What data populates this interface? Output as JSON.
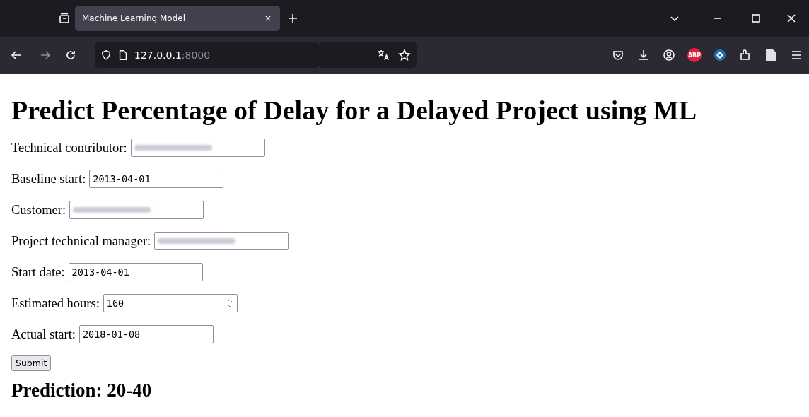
{
  "browser": {
    "tab": {
      "title": "Machine Learning Model",
      "selected": true
    },
    "url_host": "127.0.0.1",
    "url_port": ":8000",
    "extension_badge": "ABP"
  },
  "page": {
    "heading": "Predict Percentage of Delay for a Delayed Project using ML",
    "fields": [
      {
        "label": "Technical contributor:",
        "kind": "text",
        "redacted": true
      },
      {
        "label": "Baseline start:",
        "kind": "text",
        "redacted": false,
        "value": "2013-04-01"
      },
      {
        "label": "Customer:",
        "kind": "text",
        "redacted": true
      },
      {
        "label": "Project technical manager:",
        "kind": "text",
        "redacted": true
      },
      {
        "label": "Start date:",
        "kind": "text",
        "redacted": false,
        "value": "2013-04-01"
      },
      {
        "label": "Estimated hours:",
        "kind": "number",
        "redacted": false,
        "value": "160"
      },
      {
        "label": "Actual start:",
        "kind": "text",
        "redacted": false,
        "value": "2018-01-08"
      }
    ],
    "submit": "Submit",
    "prediction": "Prediction: 20-40"
  }
}
